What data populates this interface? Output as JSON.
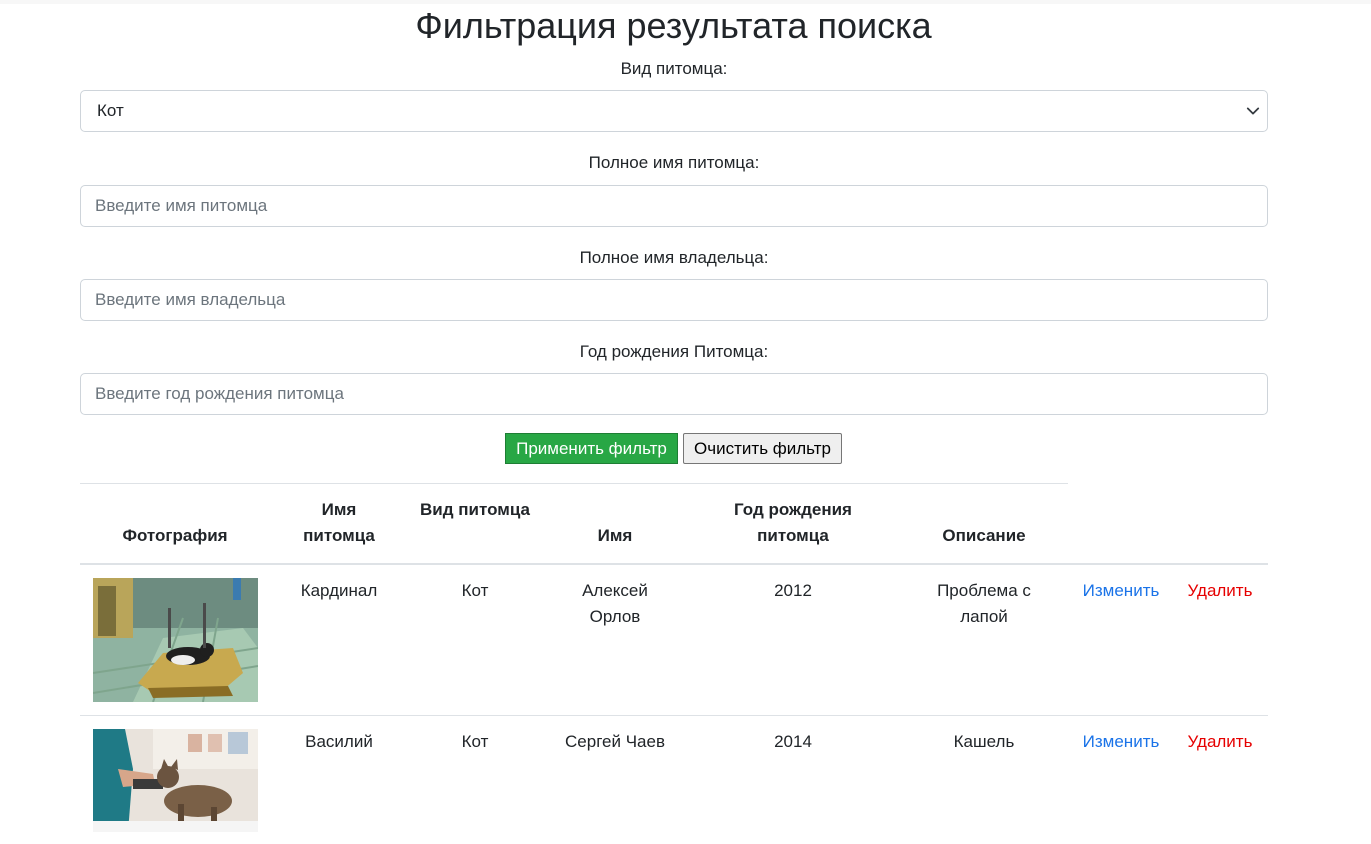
{
  "page": {
    "title": "Фильтрация результата поиска"
  },
  "filters": {
    "species": {
      "label": "Вид питомца:",
      "selected": "Кот"
    },
    "pet_name": {
      "label": "Полное имя питомца:",
      "placeholder": "Введите имя питомца"
    },
    "owner_name": {
      "label": "Полное имя владельца:",
      "placeholder": "Введите имя владельца"
    },
    "birth_year": {
      "label": "Год рождения Питомца:",
      "placeholder": "Введите год рождения питомца"
    }
  },
  "buttons": {
    "apply": "Применить фильтр",
    "clear": "Очистить фильтр"
  },
  "table": {
    "headers": {
      "photo": "Фотография",
      "pet_name": "Имя питомца",
      "species": "Вид питомца",
      "owner": "Имя",
      "birth_year": "Год рождения питомца",
      "description": "Описание"
    },
    "rows": [
      {
        "pet_name": "Кардинал",
        "species": "Кот",
        "owner": "Алексей Орлов",
        "birth_year": "2012",
        "description": "Проблема с лапой",
        "edit": "Изменить",
        "delete": "Удалить"
      },
      {
        "pet_name": "Василий",
        "species": "Кот",
        "owner": "Сергей Чаев",
        "birth_year": "2014",
        "description": "Кашель",
        "edit": "Изменить",
        "delete": "Удалить"
      }
    ]
  },
  "colors": {
    "apply_button": "#28a745",
    "edit_link": "#1a73e8",
    "delete_link": "#e60000"
  }
}
